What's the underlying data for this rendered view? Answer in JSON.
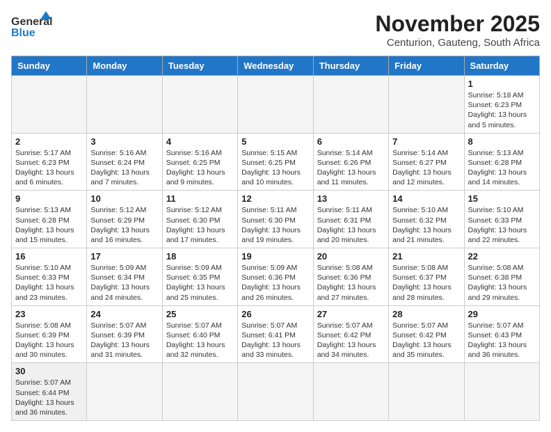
{
  "header": {
    "logo_line1": "General",
    "logo_line2": "Blue",
    "title": "November 2025",
    "subtitle": "Centurion, Gauteng, South Africa"
  },
  "weekdays": [
    "Sunday",
    "Monday",
    "Tuesday",
    "Wednesday",
    "Thursday",
    "Friday",
    "Saturday"
  ],
  "weeks": [
    [
      {
        "day": "",
        "info": ""
      },
      {
        "day": "",
        "info": ""
      },
      {
        "day": "",
        "info": ""
      },
      {
        "day": "",
        "info": ""
      },
      {
        "day": "",
        "info": ""
      },
      {
        "day": "",
        "info": ""
      },
      {
        "day": "1",
        "info": "Sunrise: 5:18 AM\nSunset: 6:23 PM\nDaylight: 13 hours and 5 minutes."
      }
    ],
    [
      {
        "day": "2",
        "info": "Sunrise: 5:17 AM\nSunset: 6:23 PM\nDaylight: 13 hours and 6 minutes."
      },
      {
        "day": "3",
        "info": "Sunrise: 5:16 AM\nSunset: 6:24 PM\nDaylight: 13 hours and 7 minutes."
      },
      {
        "day": "4",
        "info": "Sunrise: 5:16 AM\nSunset: 6:25 PM\nDaylight: 13 hours and 9 minutes."
      },
      {
        "day": "5",
        "info": "Sunrise: 5:15 AM\nSunset: 6:25 PM\nDaylight: 13 hours and 10 minutes."
      },
      {
        "day": "6",
        "info": "Sunrise: 5:14 AM\nSunset: 6:26 PM\nDaylight: 13 hours and 11 minutes."
      },
      {
        "day": "7",
        "info": "Sunrise: 5:14 AM\nSunset: 6:27 PM\nDaylight: 13 hours and 12 minutes."
      },
      {
        "day": "8",
        "info": "Sunrise: 5:13 AM\nSunset: 6:28 PM\nDaylight: 13 hours and 14 minutes."
      }
    ],
    [
      {
        "day": "9",
        "info": "Sunrise: 5:13 AM\nSunset: 6:28 PM\nDaylight: 13 hours and 15 minutes."
      },
      {
        "day": "10",
        "info": "Sunrise: 5:12 AM\nSunset: 6:29 PM\nDaylight: 13 hours and 16 minutes."
      },
      {
        "day": "11",
        "info": "Sunrise: 5:12 AM\nSunset: 6:30 PM\nDaylight: 13 hours and 17 minutes."
      },
      {
        "day": "12",
        "info": "Sunrise: 5:11 AM\nSunset: 6:30 PM\nDaylight: 13 hours and 19 minutes."
      },
      {
        "day": "13",
        "info": "Sunrise: 5:11 AM\nSunset: 6:31 PM\nDaylight: 13 hours and 20 minutes."
      },
      {
        "day": "14",
        "info": "Sunrise: 5:10 AM\nSunset: 6:32 PM\nDaylight: 13 hours and 21 minutes."
      },
      {
        "day": "15",
        "info": "Sunrise: 5:10 AM\nSunset: 6:33 PM\nDaylight: 13 hours and 22 minutes."
      }
    ],
    [
      {
        "day": "16",
        "info": "Sunrise: 5:10 AM\nSunset: 6:33 PM\nDaylight: 13 hours and 23 minutes."
      },
      {
        "day": "17",
        "info": "Sunrise: 5:09 AM\nSunset: 6:34 PM\nDaylight: 13 hours and 24 minutes."
      },
      {
        "day": "18",
        "info": "Sunrise: 5:09 AM\nSunset: 6:35 PM\nDaylight: 13 hours and 25 minutes."
      },
      {
        "day": "19",
        "info": "Sunrise: 5:09 AM\nSunset: 6:36 PM\nDaylight: 13 hours and 26 minutes."
      },
      {
        "day": "20",
        "info": "Sunrise: 5:08 AM\nSunset: 6:36 PM\nDaylight: 13 hours and 27 minutes."
      },
      {
        "day": "21",
        "info": "Sunrise: 5:08 AM\nSunset: 6:37 PM\nDaylight: 13 hours and 28 minutes."
      },
      {
        "day": "22",
        "info": "Sunrise: 5:08 AM\nSunset: 6:38 PM\nDaylight: 13 hours and 29 minutes."
      }
    ],
    [
      {
        "day": "23",
        "info": "Sunrise: 5:08 AM\nSunset: 6:39 PM\nDaylight: 13 hours and 30 minutes."
      },
      {
        "day": "24",
        "info": "Sunrise: 5:07 AM\nSunset: 6:39 PM\nDaylight: 13 hours and 31 minutes."
      },
      {
        "day": "25",
        "info": "Sunrise: 5:07 AM\nSunset: 6:40 PM\nDaylight: 13 hours and 32 minutes."
      },
      {
        "day": "26",
        "info": "Sunrise: 5:07 AM\nSunset: 6:41 PM\nDaylight: 13 hours and 33 minutes."
      },
      {
        "day": "27",
        "info": "Sunrise: 5:07 AM\nSunset: 6:42 PM\nDaylight: 13 hours and 34 minutes."
      },
      {
        "day": "28",
        "info": "Sunrise: 5:07 AM\nSunset: 6:42 PM\nDaylight: 13 hours and 35 minutes."
      },
      {
        "day": "29",
        "info": "Sunrise: 5:07 AM\nSunset: 6:43 PM\nDaylight: 13 hours and 36 minutes."
      }
    ],
    [
      {
        "day": "30",
        "info": "Sunrise: 5:07 AM\nSunset: 6:44 PM\nDaylight: 13 hours and 36 minutes."
      },
      {
        "day": "",
        "info": ""
      },
      {
        "day": "",
        "info": ""
      },
      {
        "day": "",
        "info": ""
      },
      {
        "day": "",
        "info": ""
      },
      {
        "day": "",
        "info": ""
      },
      {
        "day": "",
        "info": ""
      }
    ]
  ]
}
